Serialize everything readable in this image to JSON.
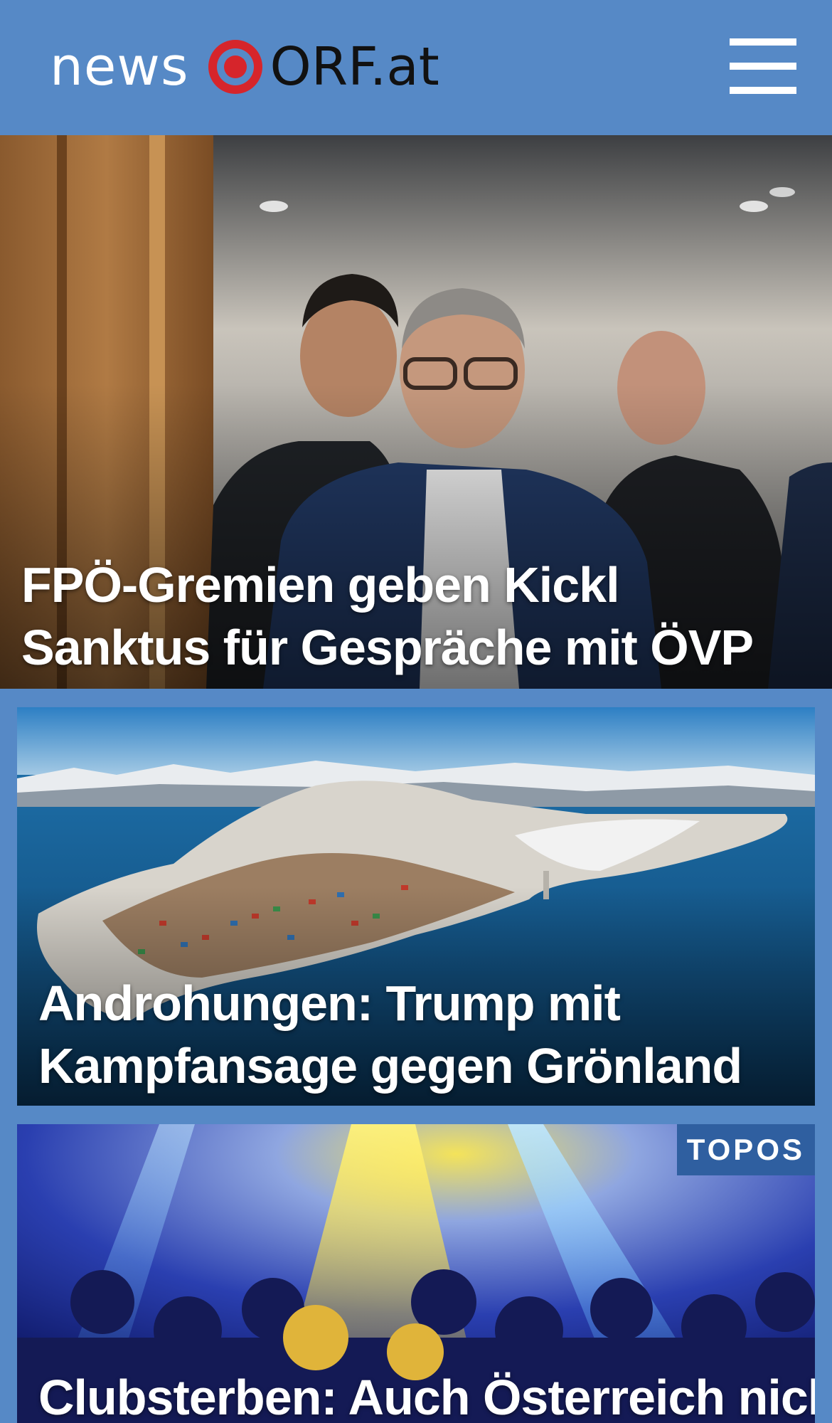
{
  "header": {
    "logo_news": "news",
    "logo_orf": "ORF.at",
    "menu_icon": "hamburger-menu-icon",
    "background": "#5689c6",
    "logo_eye_color": "#d6252b"
  },
  "stories": [
    {
      "headline": "FPÖ-Gremien geben Kickl Sanktus für Gespräche mit ÖVP",
      "image": "politicians-walking-photo"
    },
    {
      "headline": "Androhungen: Trump mit Kampfansage gegen Grönland",
      "image": "greenland-coastal-town-photo"
    },
    {
      "headline": "Clubsterben: Auch Österreich nicht",
      "badge": "TOPOS",
      "image": "nightclub-crowd-photo"
    }
  ]
}
